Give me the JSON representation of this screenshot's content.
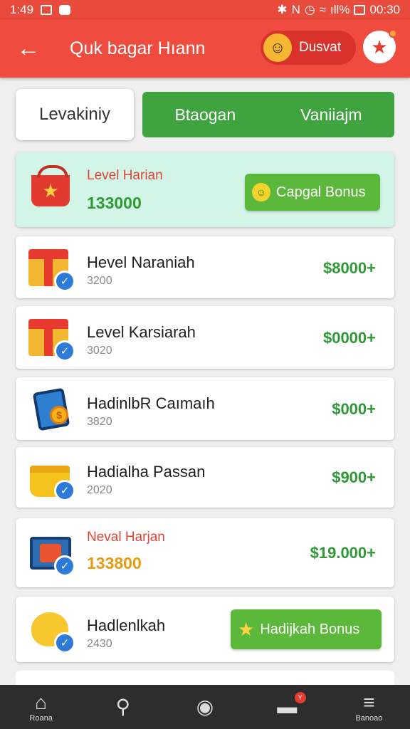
{
  "status_bar": {
    "time": "1:49",
    "clock": "00:30",
    "battery": "ıll%"
  },
  "app_bar": {
    "back_icon": "arrow-left-icon",
    "title": "Quk bagar Hıann",
    "user_name": "Dusvat"
  },
  "tabs": {
    "left": "Levakiniy",
    "right_a": "Btaogan",
    "right_b": "Vaniiajm"
  },
  "rows": [
    {
      "title": "Level Harian",
      "sub": "133000",
      "button": "Capgal Bonus",
      "icon": "basket-star-icon"
    },
    {
      "title": "Hevel Naraniah",
      "sub": "3200",
      "amount": "$8000+",
      "icon": "gift-icon"
    },
    {
      "title": "Level Karsiarah",
      "sub": "3020",
      "amount": "$0000+",
      "icon": "gift-icon"
    },
    {
      "title": "HadinlbR Caımaıh",
      "sub": "3820",
      "amount": "$000+",
      "icon": "coin-tablet-icon"
    },
    {
      "title": "Hadialha Passan",
      "sub": "2020",
      "amount": "$900+",
      "icon": "pot-icon"
    },
    {
      "title": "Neval Harjan",
      "sub": "133800",
      "amount": "$19.000+",
      "icon": "card-icon"
    },
    {
      "title": "Hadlenlkah",
      "sub": "2430",
      "button": "Hadijkah Bonus",
      "icon": "cat-icon"
    }
  ],
  "nav": [
    {
      "label": "Roana",
      "icon": "home-icon"
    },
    {
      "label": "",
      "icon": "search-icon"
    },
    {
      "label": "",
      "icon": "compass-icon"
    },
    {
      "label": "",
      "icon": "inbox-icon",
      "badge": "Y"
    },
    {
      "label": "Banoao",
      "icon": "menu-icon"
    }
  ]
}
